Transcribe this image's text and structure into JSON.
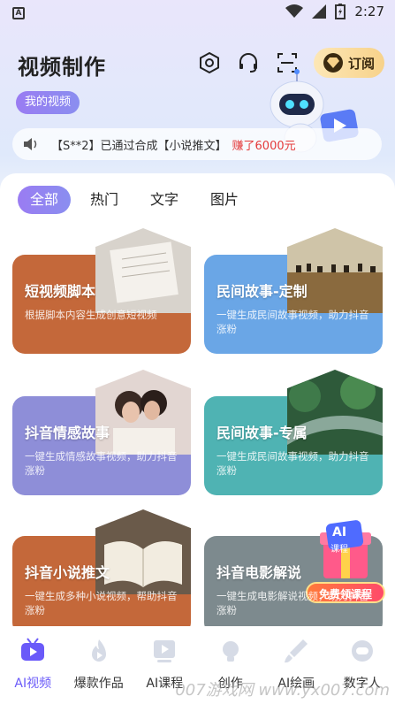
{
  "status": {
    "time": "2:27",
    "badge": "A"
  },
  "header": {
    "title": "视频制作",
    "subscribe_label": "订阅",
    "my_video_label": "我的视频"
  },
  "notice": {
    "text": "【S**2】已通过合成【小说推文】",
    "earn": "赚了6000元"
  },
  "tabs": [
    {
      "label": "全部",
      "active": true
    },
    {
      "label": "热门",
      "active": false
    },
    {
      "label": "文字",
      "active": false
    },
    {
      "label": "图片",
      "active": false
    }
  ],
  "cards": [
    {
      "title": "短视频脚本",
      "desc": "根据脚本内容生成创意短视频",
      "color": "#c4683a"
    },
    {
      "title": "民间故事-定制",
      "desc": "一键生成民间故事视频，助力抖音涨粉",
      "color": "#6aa6e6"
    },
    {
      "title": "抖音情感故事",
      "desc": "一键生成情感故事视频，助力抖音涨粉",
      "color": "#8e8ed8"
    },
    {
      "title": "民间故事-专属",
      "desc": "一键生成民间故事视频，助力抖音涨粉",
      "color": "#4fb3b3"
    },
    {
      "title": "抖音小说推文",
      "desc": "一键生成多种小说视频，帮助抖音涨粉",
      "color": "#c4683a"
    },
    {
      "title": "抖音电影解说",
      "desc": "一键生成电影解说视频，助力抖音涨粉",
      "color": "#7d8a8e"
    }
  ],
  "promo": {
    "badge": "AI",
    "sub": "课程",
    "label": "免费领课程"
  },
  "nav": [
    {
      "label": "AI视频",
      "active": true,
      "icon": "tv-icon"
    },
    {
      "label": "爆款作品",
      "active": false,
      "icon": "fire-icon"
    },
    {
      "label": "AI课程",
      "active": false,
      "icon": "play-icon"
    },
    {
      "label": "创作",
      "active": false,
      "icon": "bulb-icon"
    },
    {
      "label": "AI绘画",
      "active": false,
      "icon": "brush-icon"
    },
    {
      "label": "数字人",
      "active": false,
      "icon": "robot-icon"
    }
  ],
  "watermark": "007游戏网\nwww.yx007.com"
}
